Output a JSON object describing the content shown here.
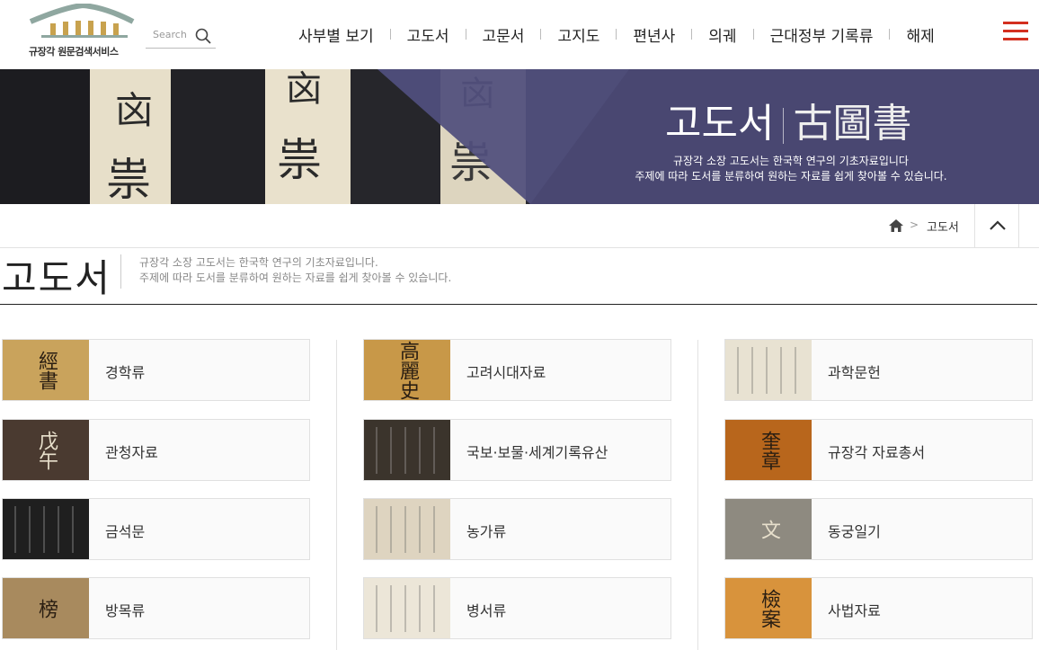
{
  "header": {
    "logo_text": "규장각 원문검색서비스",
    "search_placeholder": "Search",
    "nav": [
      "사부별 보기",
      "고도서",
      "고문서",
      "고지도",
      "편년사",
      "의궤",
      "근대정부 기록류",
      "해제"
    ]
  },
  "banner": {
    "title_ko": "고도서",
    "title_hanja": "古圖書",
    "desc_line1": "규장각 소장 고도서는 한국학 연구의 기초자료입니다",
    "desc_line2": "주제에 따라 도서를 분류하여 원하는 자료를 쉽게 찾아볼 수 있습니다."
  },
  "breadcrumb": {
    "current": "고도서",
    "arrow": ">"
  },
  "section": {
    "title": "고도서",
    "desc_line1": "규장각 소장 고도서는 한국학 연구의 기초자료입니다.",
    "desc_line2": "주제에 따라 도서를 분류하여 원하는 자료를 쉽게 찾아볼 수 있습니다."
  },
  "categories": [
    {
      "label": "경학류",
      "thumb_glyphs": "經書",
      "thumb_color": "#c9a35c"
    },
    {
      "label": "고려시대자료",
      "thumb_glyphs": "高麗史",
      "thumb_color": "#c89848"
    },
    {
      "label": "과학문헌",
      "thumb_glyphs": "",
      "thumb_color": "#e8e2d2"
    },
    {
      "label": "관청자료",
      "thumb_glyphs": "戊午",
      "thumb_color": "#4a3a30"
    },
    {
      "label": "국보·보물·세계기록유산",
      "thumb_glyphs": "",
      "thumb_color": "#3b342c"
    },
    {
      "label": "규장각 자료총서",
      "thumb_glyphs": "奎章",
      "thumb_color": "#b8661c"
    },
    {
      "label": "금석문",
      "thumb_glyphs": "",
      "thumb_color": "#1f1f1f"
    },
    {
      "label": "농가류",
      "thumb_glyphs": "",
      "thumb_color": "#ded4c0"
    },
    {
      "label": "동궁일기",
      "thumb_glyphs": "文",
      "thumb_color": "#8e8a80"
    },
    {
      "label": "방목류",
      "thumb_glyphs": "榜",
      "thumb_color": "#a88a5e"
    },
    {
      "label": "병서류",
      "thumb_glyphs": "",
      "thumb_color": "#ece6d8"
    },
    {
      "label": "사법자료",
      "thumb_glyphs": "檢案",
      "thumb_color": "#d8933c"
    }
  ]
}
